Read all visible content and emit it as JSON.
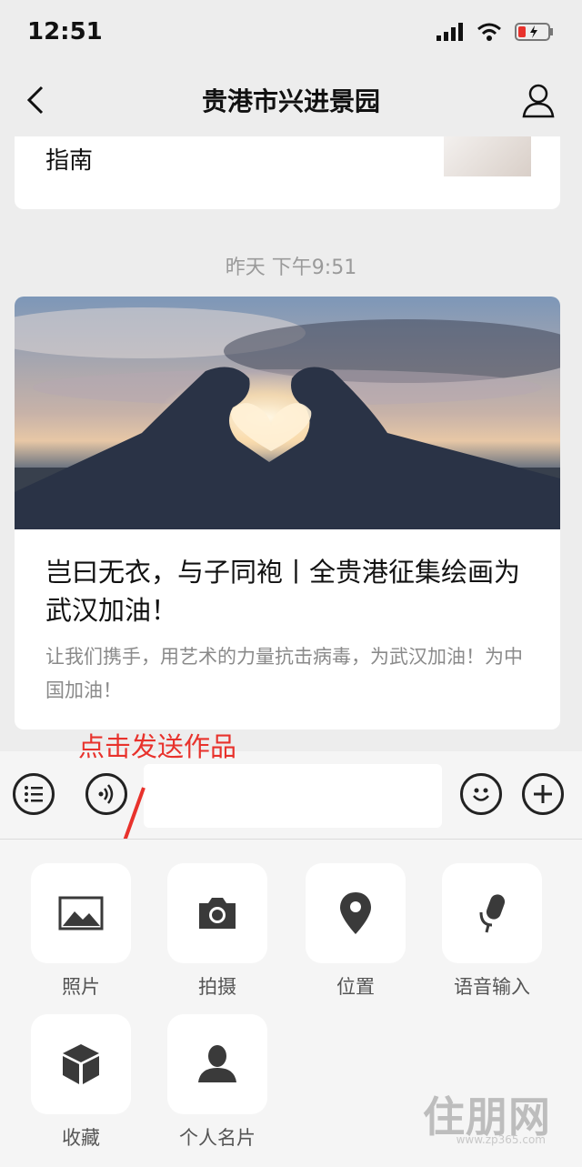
{
  "status": {
    "time": "12:51"
  },
  "nav": {
    "title": "贵港市兴进景园"
  },
  "card_top": {
    "text": "指南"
  },
  "timestamp": "昨天 下午9:51",
  "article": {
    "title": "岂曰无衣，与子同袍丨全贵港征集绘画为武汉加油！",
    "desc": "让我们携手，用艺术的力量抗击病毒，为武汉加油！为中国加油！"
  },
  "annotation": "点击发送作品",
  "panel": {
    "items": [
      {
        "label": "照片",
        "icon": "photo-icon"
      },
      {
        "label": "拍摄",
        "icon": "camera-icon"
      },
      {
        "label": "位置",
        "icon": "location-icon"
      },
      {
        "label": "语音输入",
        "icon": "microphone-icon"
      },
      {
        "label": "收藏",
        "icon": "favorites-cube-icon"
      },
      {
        "label": "个人名片",
        "icon": "contact-card-icon"
      }
    ]
  },
  "watermark": {
    "brand": "住朋网",
    "url": "www.zp365.com"
  },
  "colors": {
    "annotation": "#e8322c",
    "background": "#ededed"
  }
}
